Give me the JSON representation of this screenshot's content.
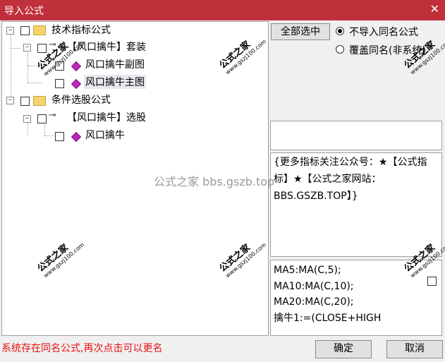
{
  "window": {
    "title": "导入公式",
    "close_glyph": "✕"
  },
  "tree": {
    "node1": {
      "label": "技术指标公式"
    },
    "node1_1": {
      "label": "【风口擒牛】套装"
    },
    "node1_1_1": {
      "label": "风口擒牛副图"
    },
    "node1_1_2": {
      "label": "风口擒牛主图"
    },
    "node2": {
      "label": "条件选股公式"
    },
    "node2_1": {
      "label": "【风口擒牛】选股"
    },
    "node2_1_1": {
      "label": "风口擒牛"
    }
  },
  "options": {
    "select_all_label": "全部选中",
    "radio_no_import": "不导入同名公式",
    "radio_overwrite": "覆盖同名(非系统)"
  },
  "description": "{更多指标关注公众号：★【公式指标】★【公式之家网站：BBS.GSZB.TOP】}",
  "code": {
    "lines": [
      "MA5:MA(C,5);",
      "MA10:MA(C,10);",
      "MA20:MA(C,20);",
      "擒牛1:=(CLOSE+HIGH"
    ]
  },
  "status_text": "系统存在同名公式,再次点击可以更名",
  "buttons": {
    "ok": "确定",
    "cancel": "取消"
  },
  "watermark": {
    "main": "公式之家",
    "url": "www.gszj100.com",
    "center": "公式之家 bbs.gszb.top"
  },
  "colors": {
    "titlebar": "#c0303a",
    "status": "#e81010"
  }
}
